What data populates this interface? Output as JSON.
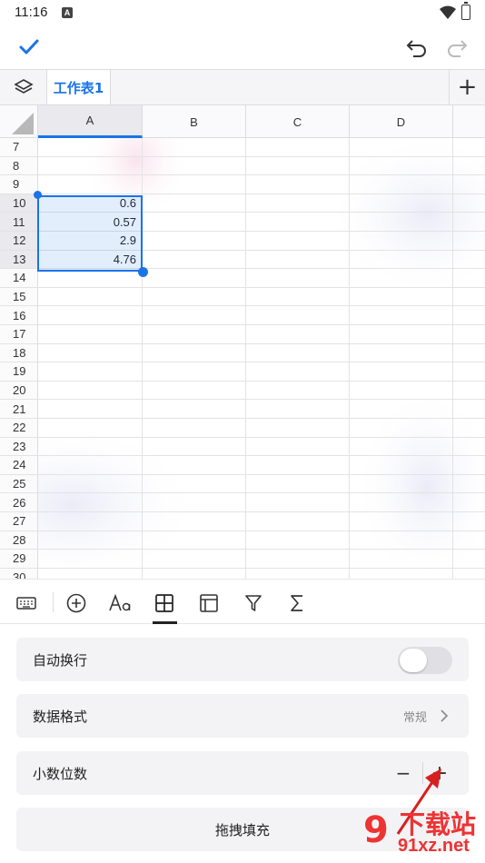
{
  "status_bar": {
    "time": "11:16",
    "app_badge": "A"
  },
  "tabs": {
    "sheet_name": "工作表1",
    "add_label": "+"
  },
  "grid": {
    "columns": [
      "A",
      "B",
      "C",
      "D"
    ],
    "rows": [
      "7",
      "8",
      "9",
      "10",
      "11",
      "12",
      "13",
      "14",
      "15",
      "16",
      "17",
      "18",
      "19",
      "20",
      "21",
      "22",
      "23",
      "24",
      "25",
      "26",
      "27",
      "28",
      "29",
      "30"
    ],
    "cells": {
      "A10": "0.6",
      "A11": "0.57",
      "A12": "2.9",
      "A13": "4.76"
    }
  },
  "panel": {
    "wrap_label": "自动换行",
    "format_label": "数据格式",
    "format_value": "常规",
    "decimals_label": "小数位数",
    "minus_label": "−",
    "plus_label": "+",
    "drag_fill_label": "拖拽填充"
  },
  "watermark": {
    "logo": "9",
    "title": "下载站",
    "site": "91xz.net"
  },
  "colors": {
    "accent": "#1a73e8",
    "watermark": "#e33333"
  }
}
